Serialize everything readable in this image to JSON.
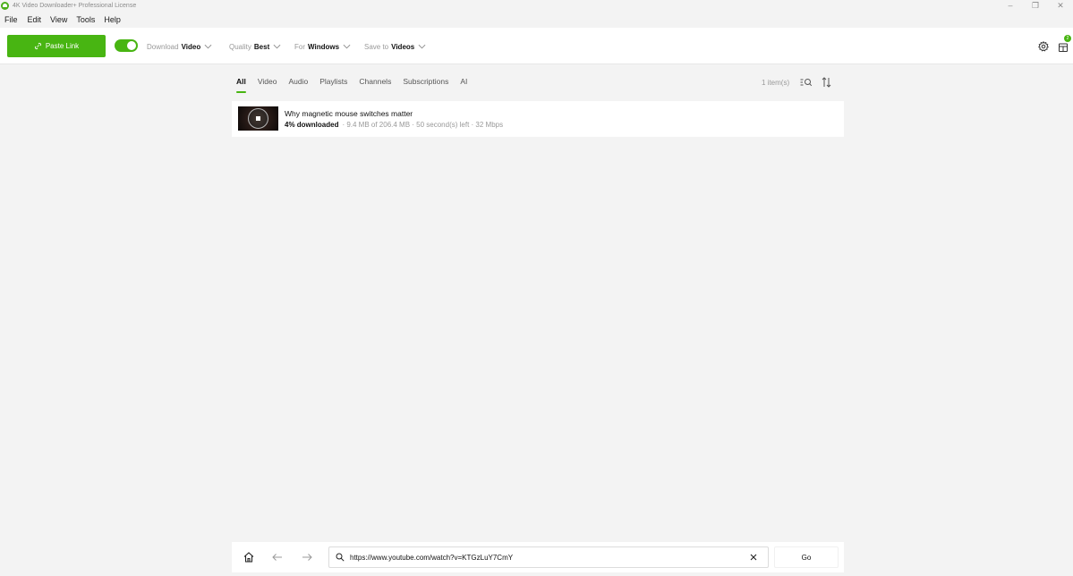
{
  "window": {
    "title": "4K Video Downloader+ Professional License",
    "minimize": "–",
    "restore": "❐",
    "close": "✕"
  },
  "menu": [
    "File",
    "Edit",
    "View",
    "Tools",
    "Help"
  ],
  "toolbar": {
    "paste_label": "Paste Link",
    "smart_mode_on": true,
    "download_label": "Download",
    "download_value": "Video",
    "quality_label": "Quality",
    "quality_value": "Best",
    "for_label": "For",
    "for_value": "Windows",
    "save_label": "Save to",
    "save_value": "Videos",
    "notification_count": "2"
  },
  "tabs": [
    "All",
    "Video",
    "Audio",
    "Playlists",
    "Channels",
    "Subscriptions",
    "AI"
  ],
  "active_tab": "All",
  "item_count": "1 item(s)",
  "items": [
    {
      "title": "Why magnetic mouse switches matter",
      "progress_text": "4% downloaded",
      "progress": 0.04,
      "meta": "· 9.4 MB of 206.4 MB · 50 second(s) left · 32 Mbps"
    }
  ],
  "browser": {
    "url": "https://www.youtube.com/watch?v=KTGzLuY7CmY",
    "go_label": "Go"
  },
  "colors": {
    "accent": "#48b512",
    "background": "#f3f3f3",
    "surface": "#ffffff"
  }
}
